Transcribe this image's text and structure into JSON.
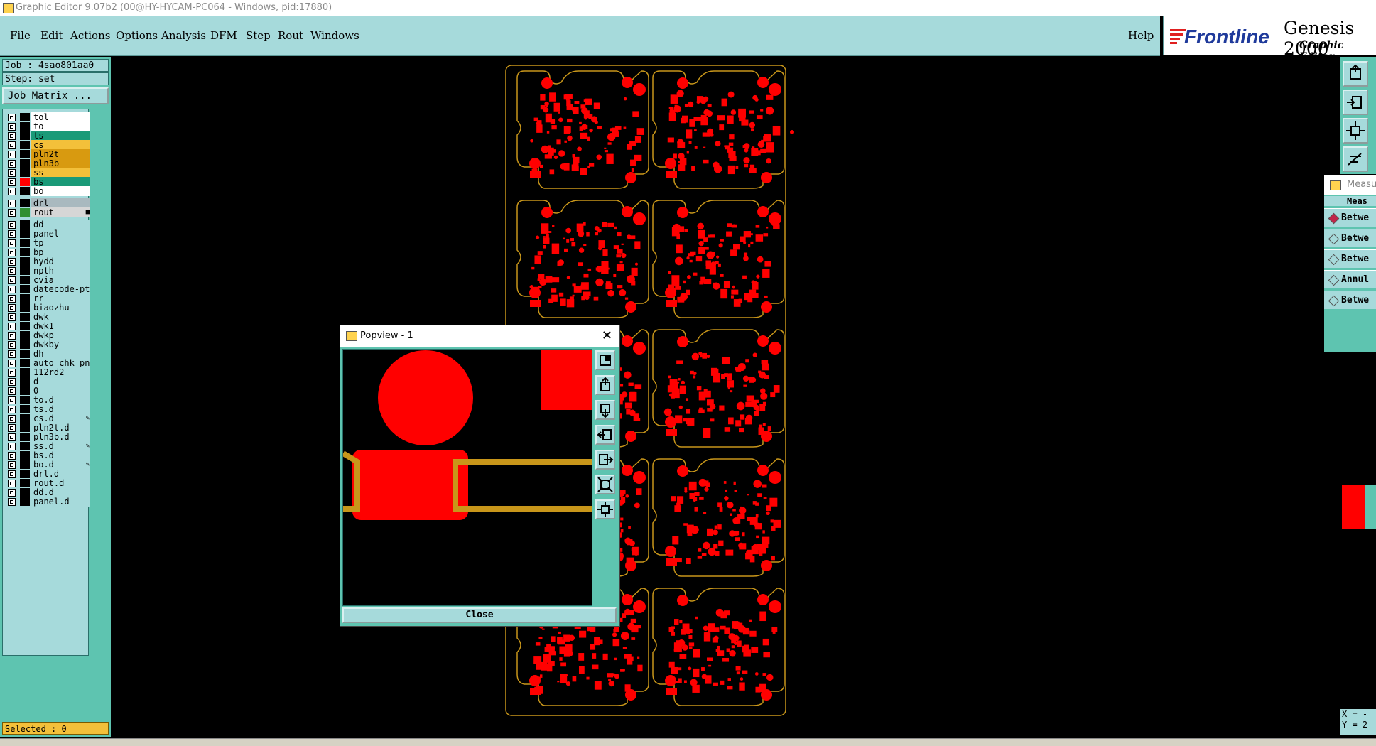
{
  "window": {
    "title": "Graphic Editor 9.07b2 (00@HY-HYCAM-PC064 - Windows, pid:17880)"
  },
  "menu": {
    "items": [
      {
        "label": "File"
      },
      {
        "label": "Edit"
      },
      {
        "label": "Actions"
      },
      {
        "label": "Options"
      },
      {
        "label": "Analysis"
      },
      {
        "label": "DFM"
      },
      {
        "label": "Step"
      },
      {
        "label": "Rout"
      },
      {
        "label": "Windows"
      }
    ],
    "help": "Help"
  },
  "brand": {
    "logo_text": "Frontline",
    "product": "Genesis 2000",
    "subtitle": "Graphic Editor"
  },
  "job": {
    "job_label": "Job : 4sao801aa0",
    "step_label": "Step: set",
    "matrix_button": "Job Matrix ..."
  },
  "layers": [
    {
      "name": "tol",
      "color": "#ffffff",
      "swatch": "#000000"
    },
    {
      "name": "to",
      "color": "#ffffff",
      "swatch": "#000000"
    },
    {
      "name": "ts",
      "color": "#1a9a78",
      "swatch": "#000000"
    },
    {
      "name": "cs",
      "color": "#f3c03a",
      "swatch": "#000000"
    },
    {
      "name": "pln2t",
      "color": "#d89a10",
      "swatch": "#000000"
    },
    {
      "name": "pln3b",
      "color": "#d89a10",
      "swatch": "#000000"
    },
    {
      "name": "ss",
      "color": "#f3c03a",
      "swatch": "#000000"
    },
    {
      "name": "bs",
      "color": "#1a9a78",
      "swatch": "#ff0000"
    },
    {
      "name": "bo",
      "color": "#ffffff",
      "swatch": "#000000"
    },
    {
      "name": "drl",
      "color": "#a9b9bf",
      "swatch": "#000000"
    },
    {
      "name": "rout",
      "color": "#d6d6d6",
      "swatch": "#2f8f2f",
      "mark": "■"
    },
    {
      "name": "dd",
      "color": "#a6dadb",
      "swatch": "#000000"
    },
    {
      "name": "panel",
      "color": "#a6dadb",
      "swatch": "#000000"
    },
    {
      "name": "tp",
      "color": "#a6dadb",
      "swatch": "#000000"
    },
    {
      "name": "bp",
      "color": "#a6dadb",
      "swatch": "#000000"
    },
    {
      "name": "hydd",
      "color": "#a6dadb",
      "swatch": "#000000"
    },
    {
      "name": "npth",
      "color": "#a6dadb",
      "swatch": "#000000"
    },
    {
      "name": "cvia",
      "color": "#a6dadb",
      "swatch": "#000000"
    },
    {
      "name": "datecode-pte",
      "color": "#a6dadb",
      "swatch": "#000000"
    },
    {
      "name": "rr",
      "color": "#a6dadb",
      "swatch": "#000000"
    },
    {
      "name": "biaozhu",
      "color": "#a6dadb",
      "swatch": "#000000"
    },
    {
      "name": "dwk",
      "color": "#a6dadb",
      "swatch": "#000000"
    },
    {
      "name": "dwk1",
      "color": "#a6dadb",
      "swatch": "#000000"
    },
    {
      "name": "dwkp",
      "color": "#a6dadb",
      "swatch": "#000000"
    },
    {
      "name": "dwkby",
      "color": "#a6dadb",
      "swatch": "#000000"
    },
    {
      "name": "dh",
      "color": "#a6dadb",
      "swatch": "#000000"
    },
    {
      "name": "auto_chk_pn",
      "color": "#a6dadb",
      "swatch": "#000000"
    },
    {
      "name": "112rd2",
      "color": "#a6dadb",
      "swatch": "#000000"
    },
    {
      "name": "d",
      "color": "#a6dadb",
      "swatch": "#000000"
    },
    {
      "name": "0",
      "color": "#a6dadb",
      "swatch": "#000000"
    },
    {
      "name": "to.d",
      "color": "#a6dadb",
      "swatch": "#000000"
    },
    {
      "name": "ts.d",
      "color": "#a6dadb",
      "swatch": "#000000"
    },
    {
      "name": "cs.d",
      "color": "#a6dadb",
      "swatch": "#000000",
      "mark": "✎"
    },
    {
      "name": "pln2t.d",
      "color": "#a6dadb",
      "swatch": "#000000"
    },
    {
      "name": "pln3b.d",
      "color": "#a6dadb",
      "swatch": "#000000"
    },
    {
      "name": "ss.d",
      "color": "#a6dadb",
      "swatch": "#000000",
      "mark": "✎"
    },
    {
      "name": "bs.d",
      "color": "#a6dadb",
      "swatch": "#000000"
    },
    {
      "name": "bo.d",
      "color": "#a6dadb",
      "swatch": "#000000",
      "mark": "✎"
    },
    {
      "name": "drl.d",
      "color": "#a6dadb",
      "swatch": "#000000"
    },
    {
      "name": "rout.d",
      "color": "#a6dadb",
      "swatch": "#000000"
    },
    {
      "name": "dd.d",
      "color": "#a6dadb",
      "swatch": "#000000"
    },
    {
      "name": "panel.d",
      "color": "#a6dadb",
      "swatch": "#000000"
    }
  ],
  "status": {
    "selected": "Selected : 0"
  },
  "popview": {
    "title": "Popview - 1",
    "close_label": "Close"
  },
  "measure": {
    "title": "Measur",
    "header": "Meas",
    "options": [
      {
        "label": "Betwe",
        "active": true
      },
      {
        "label": "Betwe",
        "active": false
      },
      {
        "label": "Betwe",
        "active": false
      },
      {
        "label": "Annul",
        "active": false
      },
      {
        "label": "Betwe",
        "active": false
      }
    ]
  },
  "coords": {
    "x": "X = -",
    "y": "Y = 2"
  },
  "colors": {
    "pad": "#ff0000",
    "outline": "#c8961a",
    "trace": "#c8961a"
  }
}
